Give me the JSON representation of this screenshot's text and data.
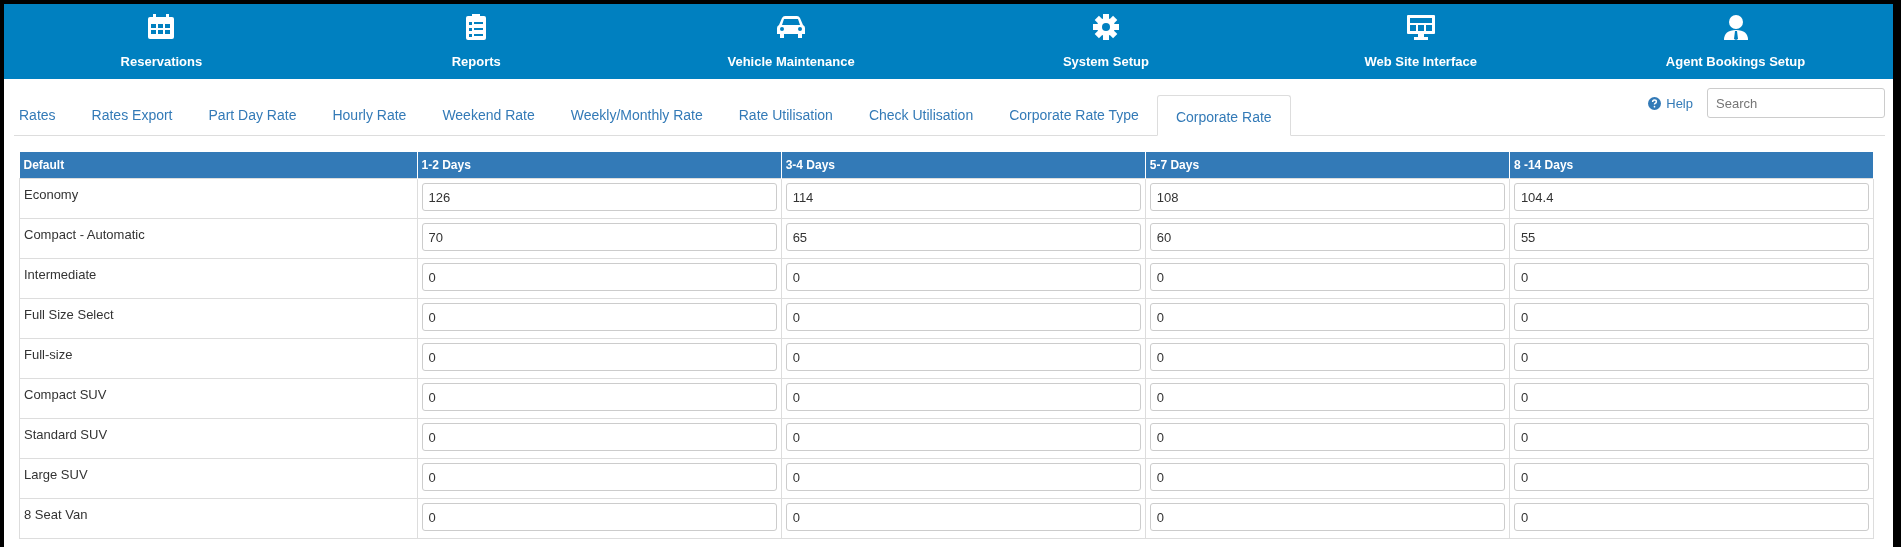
{
  "nav": [
    {
      "label": "Reservations"
    },
    {
      "label": "Reports"
    },
    {
      "label": "Vehicle Maintenance"
    },
    {
      "label": "System Setup"
    },
    {
      "label": "Web Site Interface"
    },
    {
      "label": "Agent Bookings Setup"
    }
  ],
  "tabs": [
    {
      "label": "Rates",
      "selected": false
    },
    {
      "label": "Rates Export",
      "selected": false
    },
    {
      "label": "Part Day Rate",
      "selected": false
    },
    {
      "label": "Hourly Rate",
      "selected": false
    },
    {
      "label": "Weekend Rate",
      "selected": false
    },
    {
      "label": "Weekly/Monthly Rate",
      "selected": false
    },
    {
      "label": "Rate Utilisation",
      "selected": false
    },
    {
      "label": "Check Utilisation",
      "selected": false
    },
    {
      "label": "Corporate Rate Type",
      "selected": false
    },
    {
      "label": "Corporate Rate",
      "selected": true
    }
  ],
  "help": {
    "label": "Help"
  },
  "search": {
    "placeholder": "Search"
  },
  "table": {
    "columns": [
      "Default",
      "1-2 Days",
      "3-4 Days",
      "5-7 Days",
      "8 -14 Days"
    ],
    "rows": [
      {
        "label": "Economy",
        "values": [
          "126",
          "114",
          "108",
          "104.4"
        ]
      },
      {
        "label": "Compact - Automatic",
        "values": [
          "70",
          "65",
          "60",
          "55"
        ]
      },
      {
        "label": "Intermediate",
        "values": [
          "0",
          "0",
          "0",
          "0"
        ]
      },
      {
        "label": "Full Size Select",
        "values": [
          "0",
          "0",
          "0",
          "0"
        ]
      },
      {
        "label": "Full-size",
        "values": [
          "0",
          "0",
          "0",
          "0"
        ]
      },
      {
        "label": "Compact SUV",
        "values": [
          "0",
          "0",
          "0",
          "0"
        ]
      },
      {
        "label": "Standard SUV",
        "values": [
          "0",
          "0",
          "0",
          "0"
        ]
      },
      {
        "label": "Large SUV",
        "values": [
          "0",
          "0",
          "0",
          "0"
        ]
      },
      {
        "label": "8 Seat Van",
        "values": [
          "0",
          "0",
          "0",
          "0"
        ]
      }
    ]
  }
}
